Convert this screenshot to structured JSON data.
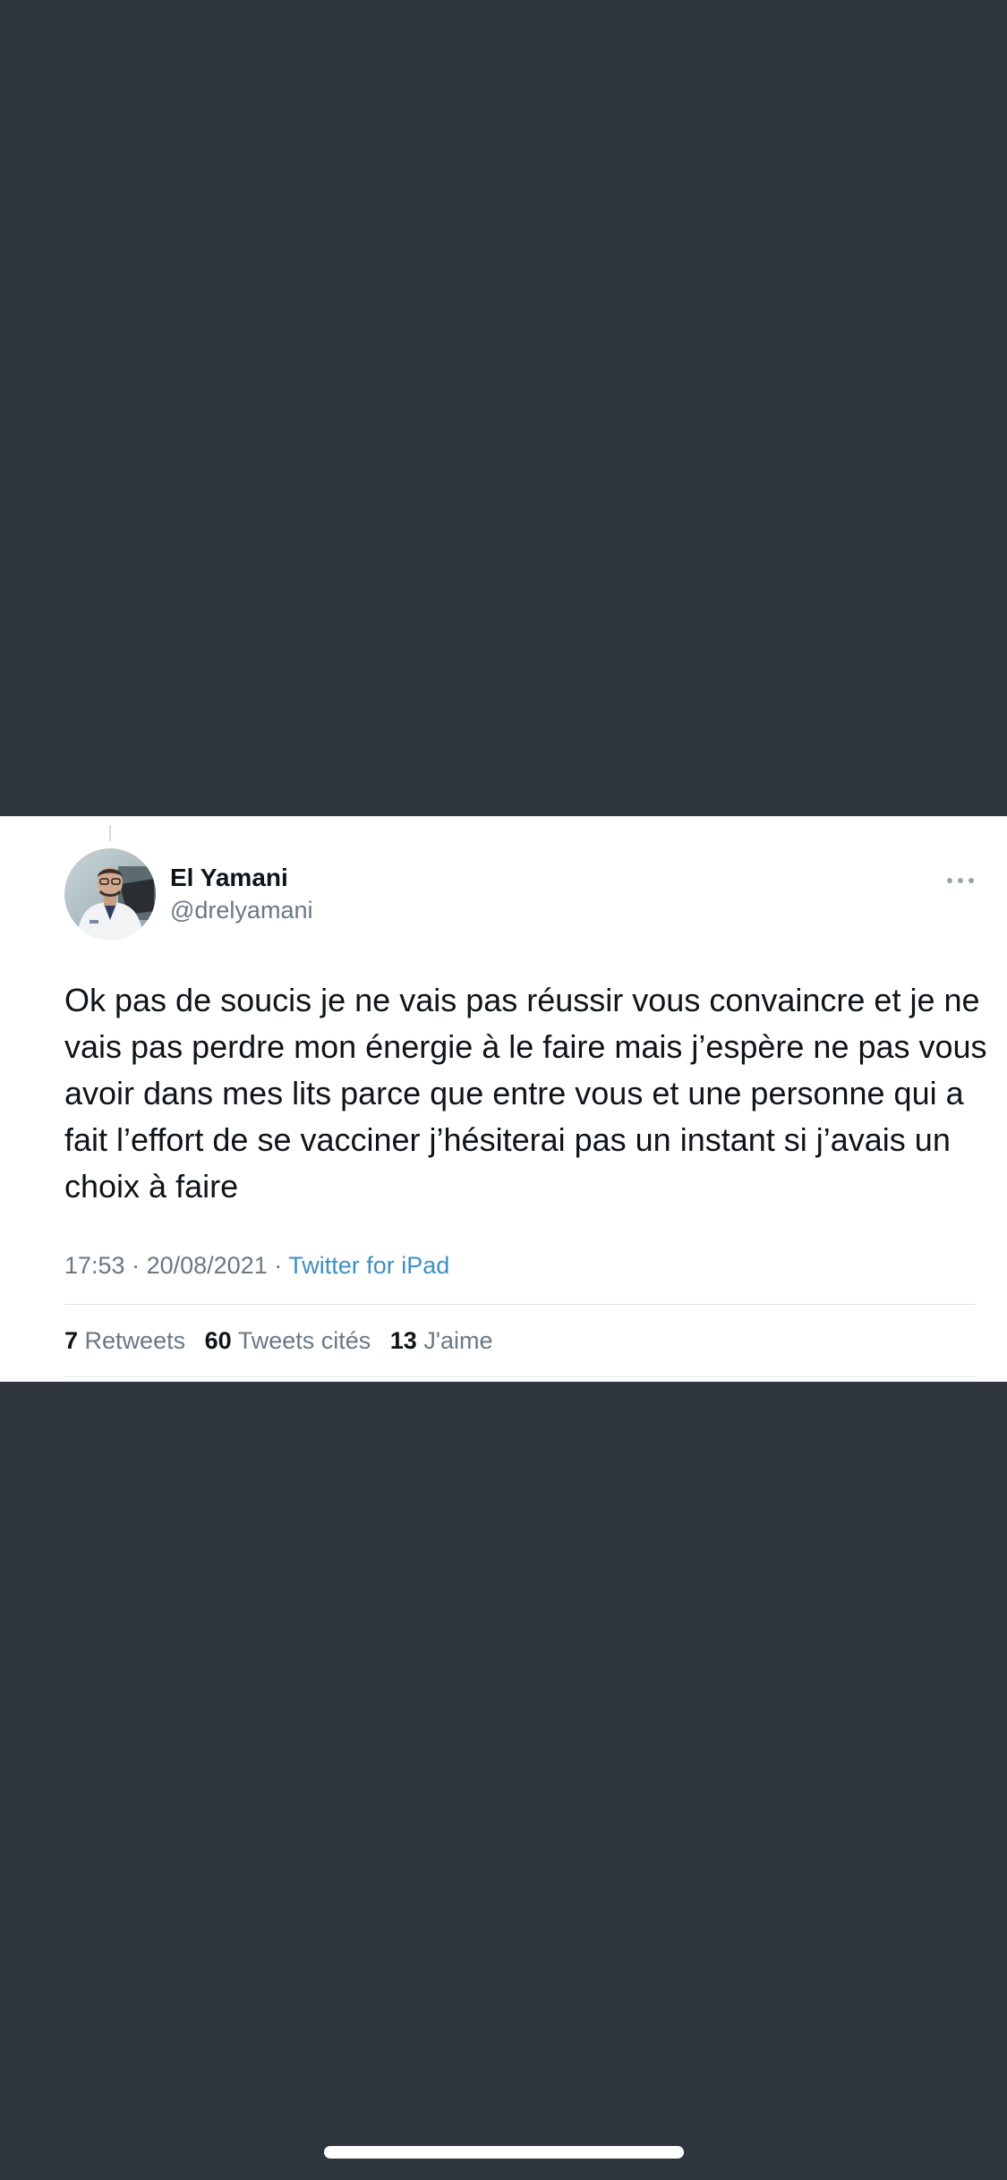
{
  "tweet": {
    "author_name": "El Yamani",
    "author_handle": "@drelyamani",
    "text": "Ok pas de soucis je ne vais pas réussir vous convaincre et je ne vais pas perdre mon énergie à le faire mais j’espère ne pas vous avoir dans mes lits parce que entre vous et une personne qui a fait l’effort de se vacciner j’hésiterai pas un instant si j’avais un choix à faire",
    "time": "17:53",
    "separator": " · ",
    "date": "20/08/2021",
    "source": "Twitter for iPad"
  },
  "stats": {
    "retweets_count": "7",
    "retweets_label": "Retweets",
    "quotes_count": "60",
    "quotes_label": "Tweets cités",
    "likes_count": "13",
    "likes_label": "J'aime"
  },
  "icons": {
    "more": "more-horizontal-icon",
    "avatar": "profile-photo"
  },
  "colors": {
    "background": "#30363e",
    "card": "#ffffff",
    "link": "#3f8fc4",
    "secondary_text": "#6b7785"
  }
}
